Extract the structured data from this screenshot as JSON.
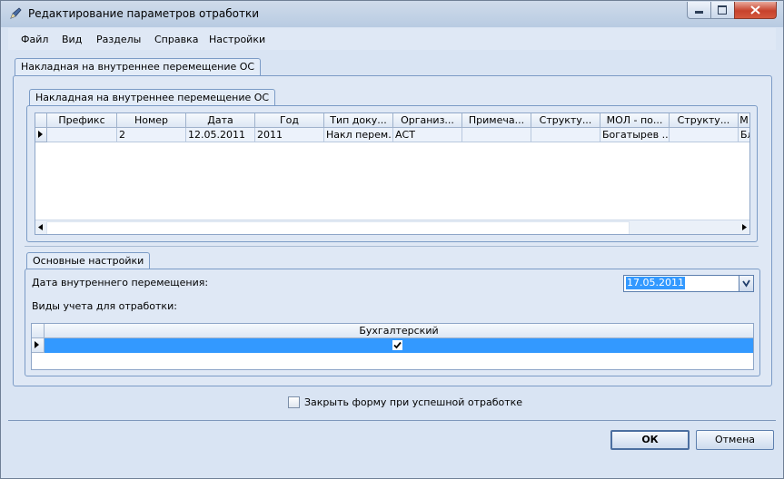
{
  "window": {
    "title": "Редактирование параметров отработки",
    "app_icon": "pen-icon",
    "controls": [
      "minimize-icon",
      "maximize-icon",
      "close-icon"
    ]
  },
  "menu": [
    {
      "label": "Файл"
    },
    {
      "label": "Вид"
    },
    {
      "label": "Разделы"
    },
    {
      "label": "Справка"
    },
    {
      "label": "Настройки"
    }
  ],
  "outer_tab": {
    "label": "Накладная на внутреннее перемещение ОС"
  },
  "inner_tab": {
    "label": "Накладная на внутреннее перемещение ОС"
  },
  "doc_grid": {
    "columns": [
      "Префикс",
      "Номер",
      "Дата",
      "Год",
      "Тип доку...",
      "Организ...",
      "Примеча...",
      "Структу...",
      "МОЛ - по...",
      "Структу...",
      "М"
    ],
    "rows": [
      [
        "",
        "2",
        "12.05.2011",
        "2011",
        "Накл перем...",
        "АСТ",
        "",
        "",
        "Богатырев ...",
        "",
        "Бл"
      ]
    ]
  },
  "settings": {
    "tab_label": "Основные настройки",
    "date_label": "Дата внутреннего перемещения:",
    "date_value": "17.05.2011",
    "accounting_label": "Виды учета для отработки:",
    "accounting_column": "Бухгалтерский",
    "accounting_checked": true
  },
  "close_on_success": {
    "label": "Закрыть форму при успешной отработке",
    "checked": false
  },
  "buttons": {
    "ok": "ОК",
    "cancel": "Отмена"
  },
  "colors": {
    "selection": "#3399ff",
    "panel_border": "#7b9bc6",
    "window_bg": "#d9e4f3"
  }
}
